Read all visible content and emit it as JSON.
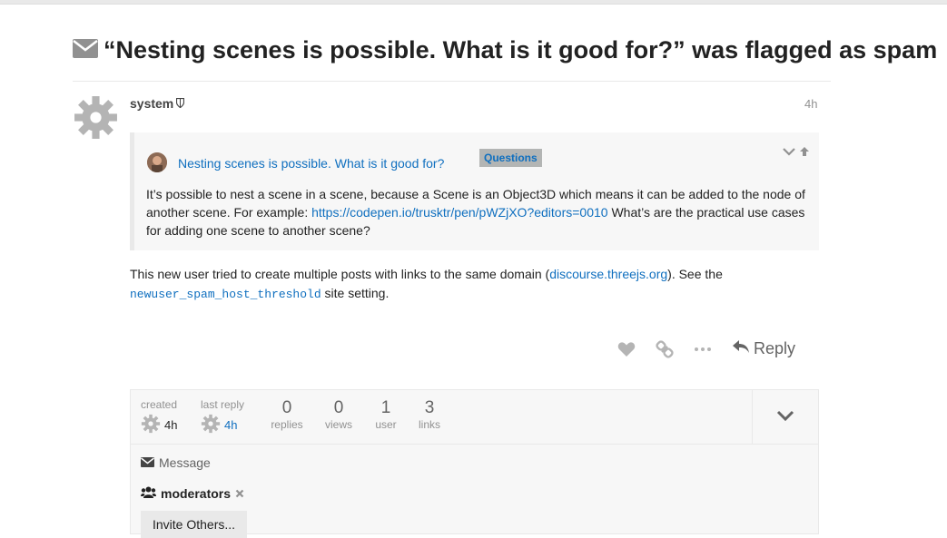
{
  "topic": {
    "title": "“Nesting scenes is possible. What is it good for?” was flagged as spam"
  },
  "post": {
    "username": "system",
    "time": "4h",
    "quote": {
      "title": "Nesting scenes is possible. What is it good for?",
      "category": "Questions",
      "body_before": "It’s possible to nest a scene in a scene, because a Scene is an Object3D which means it can be added to the node of another scene. For example: ",
      "link": "https://codepen.io/trusktr/pen/pWZjXO?editors=0010",
      "body_after": " What’s are the practical use cases for adding one scene to another scene?"
    },
    "message": {
      "text_before": "This new user tried to create multiple posts with links to the same domain (",
      "domain": "discourse.threejs.org",
      "text_middle": "). See the ",
      "setting": "newuser_spam_host_threshold",
      "text_after": " site setting."
    },
    "reply_label": "Reply"
  },
  "topic_map": {
    "created_label": "created",
    "created_time": "4h",
    "last_reply_label": "last reply",
    "last_reply_time": "4h",
    "replies_count": "0",
    "replies_label": "replies",
    "views_count": "0",
    "views_label": "views",
    "users_count": "1",
    "users_label": "user",
    "links_count": "3",
    "links_label": "links",
    "message_label": "Message",
    "group_name": "moderators",
    "invite_label": "Invite Others..."
  },
  "colors": {
    "link": "#0f6fbf",
    "muted": "#919191",
    "quote_bg": "#f7f7f7"
  },
  "icons": [
    "envelope-icon",
    "gear-icon",
    "shield-icon",
    "chevron-down-icon",
    "arrow-up-icon",
    "heart-icon",
    "link-icon",
    "ellipsis-icon",
    "reply-icon",
    "users-icon",
    "times-icon"
  ]
}
